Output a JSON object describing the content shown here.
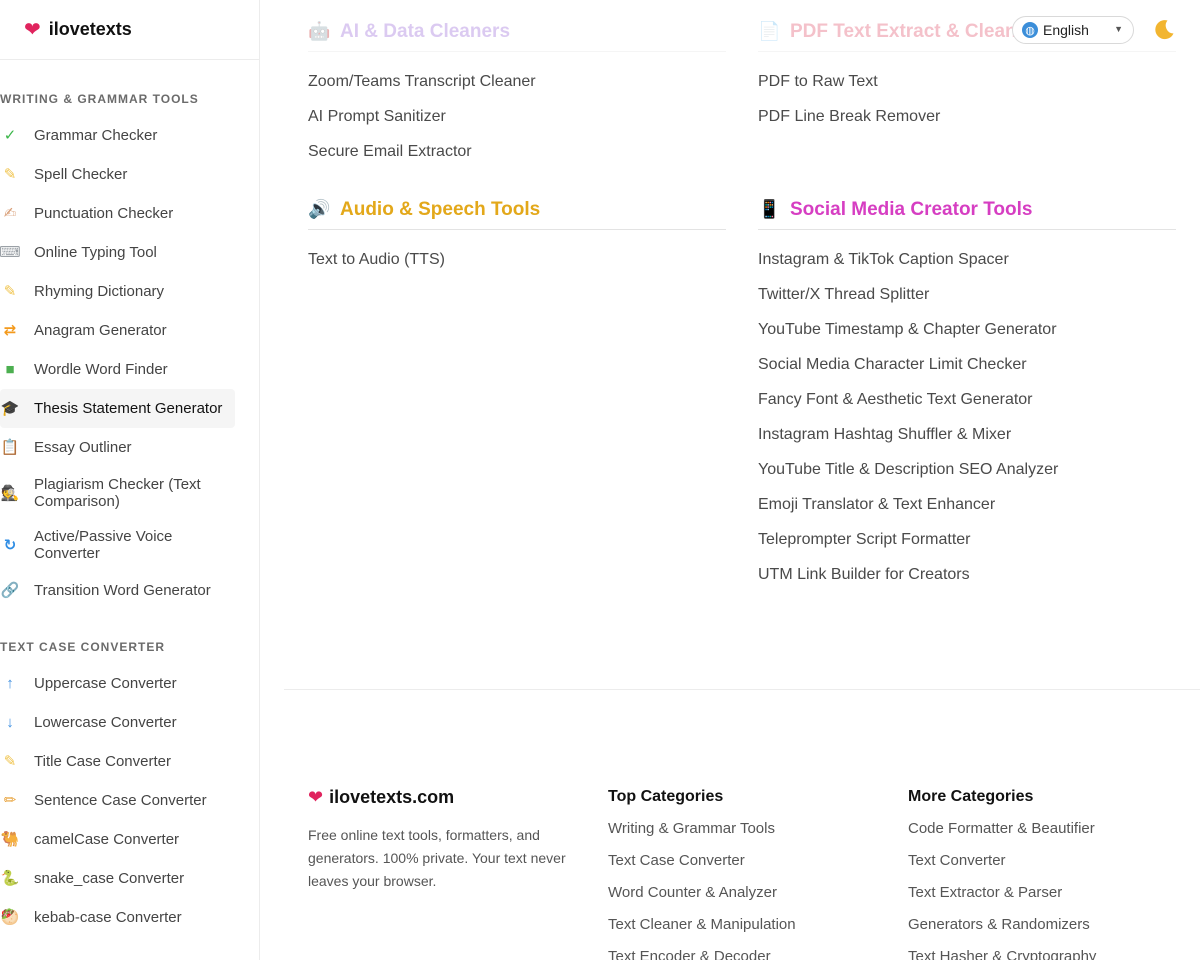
{
  "brand": {
    "name": "ilovetexts"
  },
  "sidebar": {
    "sections": [
      {
        "heading": "WRITING & GRAMMAR TOOLS",
        "items": [
          {
            "icon": "check-icon",
            "glyph": "✓",
            "color": "#3cb64a",
            "label": "Grammar Checker"
          },
          {
            "icon": "memo-icon",
            "glyph": "✎",
            "color": "#f0c34a",
            "label": "Spell Checker"
          },
          {
            "icon": "writing-hand-icon",
            "glyph": "✍",
            "color": "#d9a07a",
            "label": "Punctuation Checker"
          },
          {
            "icon": "keyboard-icon",
            "glyph": "⌨",
            "color": "#9aa0a6",
            "label": "Online Typing Tool"
          },
          {
            "icon": "memo-icon",
            "glyph": "✎",
            "color": "#f0c34a",
            "label": "Rhyming Dictionary"
          },
          {
            "icon": "shuffle-icon",
            "glyph": "⇄",
            "color": "#f39a1d",
            "label": "Anagram Generator"
          },
          {
            "icon": "green-square-icon",
            "glyph": "■",
            "color": "#4caf50",
            "label": "Wordle Word Finder"
          },
          {
            "icon": "graduation-cap-icon",
            "glyph": "🎓",
            "color": "#222222",
            "label": "Thesis Statement Generator",
            "active": true
          },
          {
            "icon": "clipboard-icon",
            "glyph": "📋",
            "color": "#c58b4b",
            "label": "Essay Outliner"
          },
          {
            "icon": "detective-icon",
            "glyph": "🕵",
            "color": "#5a5a5a",
            "label": "Plagiarism Checker (Text Comparison)",
            "tall": true
          },
          {
            "icon": "refresh-icon",
            "glyph": "↻",
            "color": "#2f8de4",
            "label": "Active/Passive Voice Converter",
            "tall": true
          },
          {
            "icon": "link-icon",
            "glyph": "🔗",
            "color": "#7c8a99",
            "label": "Transition Word Generator"
          }
        ]
      },
      {
        "heading": "TEXT CASE CONVERTER",
        "items": [
          {
            "icon": "up-arrow-icon",
            "glyph": "↑",
            "color": "#3d8fe0",
            "label": "Uppercase Converter"
          },
          {
            "icon": "down-arrow-icon",
            "glyph": "↓",
            "color": "#3d8fe0",
            "label": "Lowercase Converter"
          },
          {
            "icon": "memo-icon",
            "glyph": "✎",
            "color": "#f0c34a",
            "label": "Title Case Converter"
          },
          {
            "icon": "pencil-icon",
            "glyph": "✏",
            "color": "#e8a23a",
            "label": "Sentence Case Converter"
          },
          {
            "icon": "camel-icon",
            "glyph": "🐫",
            "color": "#c89a5a",
            "label": "camelCase Converter"
          },
          {
            "icon": "snake-icon",
            "glyph": "🐍",
            "color": "#5aa84a",
            "label": "snake_case Converter"
          },
          {
            "icon": "kebab-icon",
            "glyph": "🥙",
            "color": "#d88a4a",
            "label": "kebab-case Converter"
          }
        ]
      }
    ]
  },
  "topbar": {
    "language": "English",
    "theme_icon": "moon-icon"
  },
  "categories": [
    {
      "id": "ai",
      "title": "AI & Data Cleaners",
      "icon": "robot-icon",
      "glyph": "🤖",
      "color": "#9b6ad8",
      "links": [
        "Zoom/Teams Transcript Cleaner",
        "AI Prompt Sanitizer",
        "Secure Email Extractor"
      ]
    },
    {
      "id": "pdf",
      "title": "PDF Text Extract & Clean",
      "icon": "page-icon",
      "glyph": "📄",
      "color": "#e0506a",
      "links": [
        "PDF to Raw Text",
        "PDF Line Break Remover"
      ]
    },
    {
      "id": "audio",
      "title": "Audio & Speech Tools",
      "icon": "speaker-icon",
      "glyph": "🔊",
      "color": "#e3a81a",
      "links": [
        "Text to Audio (TTS)"
      ]
    },
    {
      "id": "social",
      "title": "Social Media Creator Tools",
      "icon": "mobile-phone-icon",
      "glyph": "📱",
      "color": "#d63ec2",
      "links": [
        "Instagram & TikTok Caption Spacer",
        "Twitter/X Thread Splitter",
        "YouTube Timestamp & Chapter Generator",
        "Social Media Character Limit Checker",
        "Fancy Font & Aesthetic Text Generator",
        "Instagram Hashtag Shuffler & Mixer",
        "YouTube Title & Description SEO Analyzer",
        "Emoji Translator & Text Enhancer",
        "Teleprompter Script Formatter",
        "UTM Link Builder for Creators"
      ]
    }
  ],
  "footer": {
    "brand": "ilovetexts.com",
    "description": "Free online text tools, formatters, and generators. 100% private. Your text never leaves your browser.",
    "top_categories": {
      "heading": "Top Categories",
      "links": [
        "Writing & Grammar Tools",
        "Text Case Converter",
        "Word Counter & Analyzer",
        "Text Cleaner & Manipulation",
        "Text Encoder & Decoder"
      ]
    },
    "more_categories": {
      "heading": "More Categories",
      "links": [
        "Code Formatter & Beautifier",
        "Text Converter",
        "Text Extractor & Parser",
        "Generators & Randomizers",
        "Text Hasher & Cryptography"
      ]
    }
  },
  "colors": {
    "heart": "#e0245e",
    "moon": "#f2b530"
  }
}
